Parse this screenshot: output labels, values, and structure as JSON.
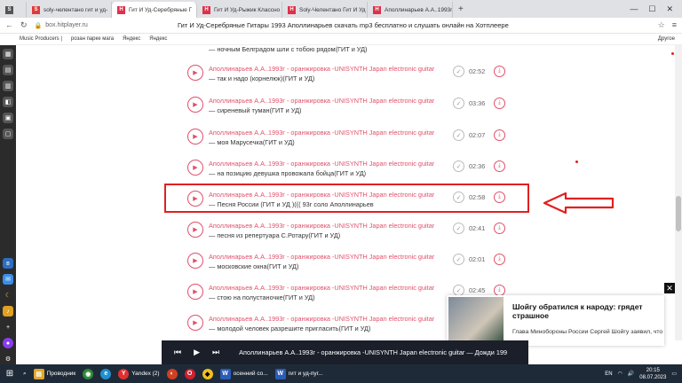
{
  "browser": {
    "tabs": [
      {
        "label": "",
        "favicon_text": "S",
        "color": "#555555"
      },
      {
        "label": "soly-челентано гит и уд-",
        "favicon_text": "S",
        "color": "#e03a3a"
      },
      {
        "label": "Гит И Уд-Серебряные Г",
        "favicon_text": "H",
        "color": "#e0304a"
      },
      {
        "label": "Гит И Уд-Рыжик Классно",
        "favicon_text": "H",
        "color": "#e0304a"
      },
      {
        "label": "Soly-Челентано Гит И Уд",
        "favicon_text": "H",
        "color": "#e0304a"
      },
      {
        "label": "Аполлинарьев А.А..1993г",
        "favicon_text": "H",
        "color": "#e0304a"
      }
    ],
    "active_tab": 2,
    "new_tab": "+",
    "url": "box.hitplayer.ru",
    "page_title": "Гит И Уд-Серебряные Гитары 1993 Аполлинарьев скачать mp3 бесплатно и слушать онлайн на Хотплеере",
    "bookmarks": [
      "Music Producers |",
      "розан парке мага",
      "Яндекс",
      "Яндекс"
    ],
    "other_bookmarks": "Другое"
  },
  "tracks": [
    {
      "artist": "",
      "song": "— ночным Белградом шли с тобою рядом(ГИТ и УД)",
      "duration": ""
    },
    {
      "artist": "Аполлинарьев А.А..1993г - оранжировка -UNISYNTH Japan electronic guitar",
      "song": "— так и надо (корнелюк)(ГИТ и УД)",
      "duration": "02:52"
    },
    {
      "artist": "Аполлинарьев А.А..1993г - оранжировка -UNISYNTH Japan electronic guitar",
      "song": "— сиреневый туман(ГИТ и УД)",
      "duration": "03:36"
    },
    {
      "artist": "Аполлинарьев А.А..1993г - оранжировка -UNISYNTH Japan electronic guitar",
      "song": "— моя Марусечка(ГИТ и УД)",
      "duration": "02:07"
    },
    {
      "artist": "Аполлинарьев А.А..1993г - оранжировка -UNISYNTH Japan electronic guitar",
      "song": "— на позицию девушка провожала бойца(ГИТ и УД)",
      "duration": "02:36"
    },
    {
      "artist": "Аполлинарьев А.А..1993г - оранжировка -UNISYNTH Japan electronic guitar",
      "song": "— Песня России (ГИТ и УД )((( 93г соло Аполлинарьев",
      "duration": "02:58"
    },
    {
      "artist": "Аполлинарьев А.А..1993г - оранжировка -UNISYNTH Japan electronic guitar",
      "song": "— песня из репертуара С.Ротару(ГИТ и УД)",
      "duration": "02:41"
    },
    {
      "artist": "Аполлинарьев А.А..1993г - оранжировка -UNISYNTH Japan electronic guitar",
      "song": "— московские окна(ГИТ и УД)",
      "duration": "02:01"
    },
    {
      "artist": "Аполлинарьев А.А..1993г - оранжировка -UNISYNTH Japan electronic guitar",
      "song": "— стою на полустаночке(ГИТ и УД)",
      "duration": "02:45"
    },
    {
      "artist": "Аполлинарьев А.А..1993г - оранжировка -UNISYNTH Japan electronic guitar",
      "song": "— молодой человек разрешите пригласить(ГИТ и УД)",
      "duration": "02:49"
    }
  ],
  "news": {
    "title": "Шойгу обратился к народу: грядет страшное",
    "body": "Глава Минобороны России Сергей Шойгу заявил, что Североатлантический альянс",
    "close": "✕"
  },
  "player": {
    "now_playing": "Аполлинарьев А.А..1993г - оранжировка -UNISYNTH Japan electronic guitar — Дожди 199"
  },
  "taskbar": {
    "items": [
      {
        "label": "Проводник",
        "icon_text": "▤",
        "color": "#e0a82e"
      },
      {
        "label": "Yandex (2)",
        "icon_text": "Y",
        "color": "#e03030"
      },
      {
        "label": "осенний со...",
        "icon_text": "W",
        "color": "#2b5cb8"
      },
      {
        "label": "гит и уд-пуг...",
        "icon_text": "W",
        "color": "#2b5cb8"
      }
    ],
    "lang": "EN",
    "time": "20:15",
    "date": "08.07.2023"
  }
}
